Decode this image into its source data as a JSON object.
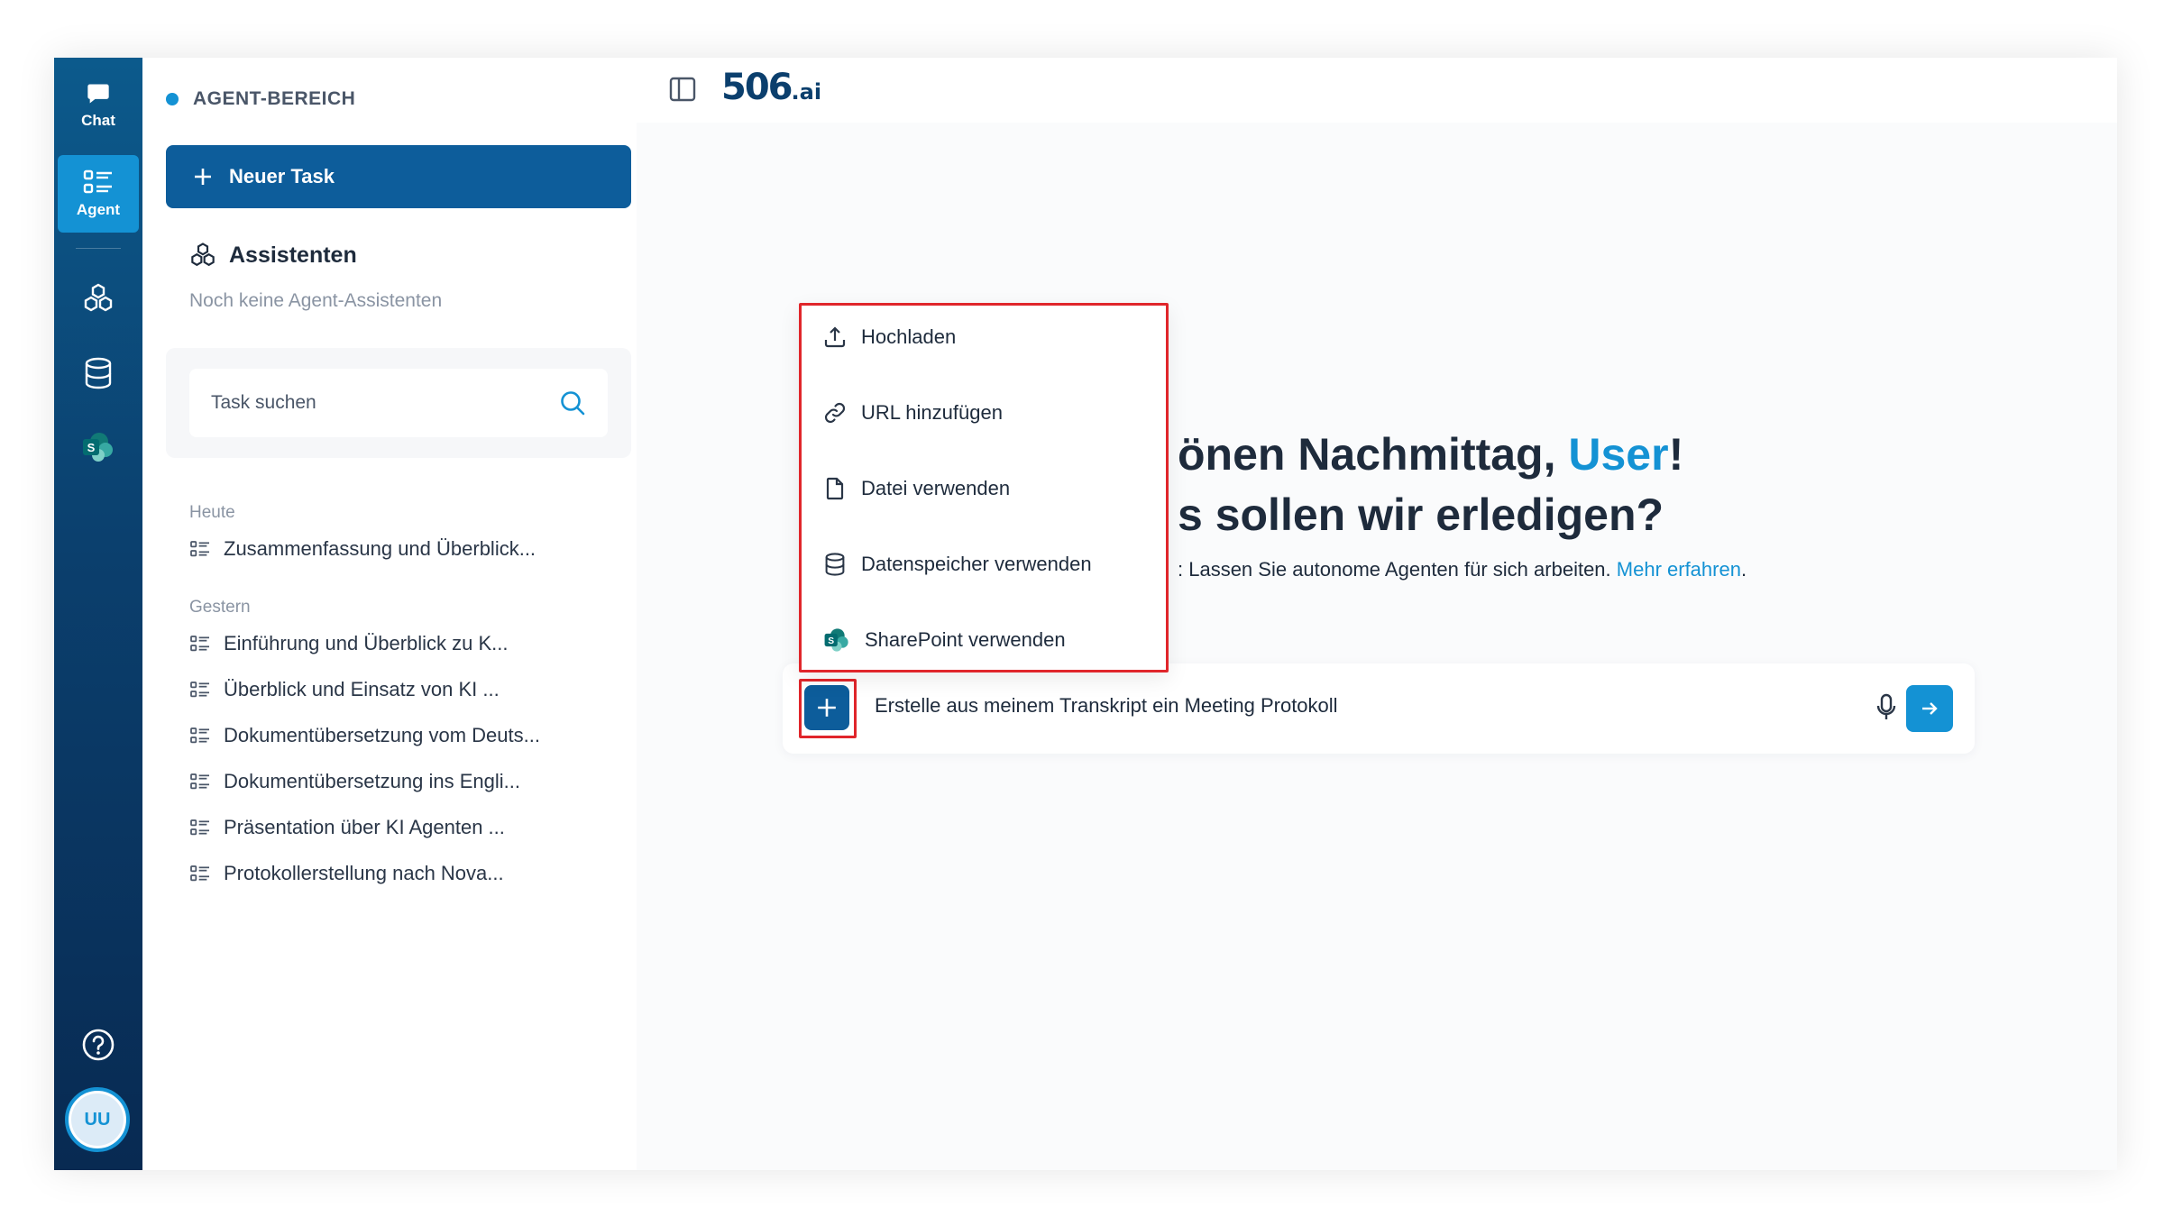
{
  "rail": {
    "chat_label": "Chat",
    "agent_label": "Agent",
    "avatar_initials": "UU"
  },
  "sidebar": {
    "area_title": "AGENT-BEREICH",
    "new_task_label": "Neuer Task",
    "assistants_title": "Assistenten",
    "assistants_empty": "Noch keine Agent-Assistenten",
    "search_placeholder": "Task suchen",
    "groups": [
      {
        "label": "Heute",
        "items": [
          "Zusammenfassung und Überblick..."
        ]
      },
      {
        "label": "Gestern",
        "items": [
          "Einführung und Überblick zu K...",
          "Überblick und Einsatz von KI ...",
          "Dokumentübersetzung vom Deuts...",
          "Dokumentübersetzung ins Engli...",
          "Präsentation über KI Agenten ...",
          "Protokollerstellung nach Nova..."
        ]
      }
    ]
  },
  "header": {
    "logo_main": "506",
    "logo_suffix": ".ai"
  },
  "main": {
    "greeting_prefix": "önen Nachmittag, ",
    "greeting_user": "User",
    "greeting_suffix": "!",
    "greeting_line2": "s sollen wir erledigen?",
    "tagline": ": Lassen Sie autonome Agenten für sich arbeiten. ",
    "tagline_link": "Mehr erfahren",
    "tagline_end": ".",
    "prompt_text": "Erstelle aus meinem Transkript ein Meeting Protokoll"
  },
  "menu": {
    "items": [
      {
        "label": "Hochladen",
        "icon": "upload-icon"
      },
      {
        "label": "URL hinzufügen",
        "icon": "link-icon"
      },
      {
        "label": "Datei verwenden",
        "icon": "file-icon"
      },
      {
        "label": "Datenspeicher verwenden",
        "icon": "database-icon"
      },
      {
        "label": "SharePoint verwenden",
        "icon": "sharepoint-icon"
      }
    ]
  },
  "colors": {
    "accent": "#1492d4",
    "primary": "#0d5d9b",
    "highlight": "#e0262b"
  }
}
